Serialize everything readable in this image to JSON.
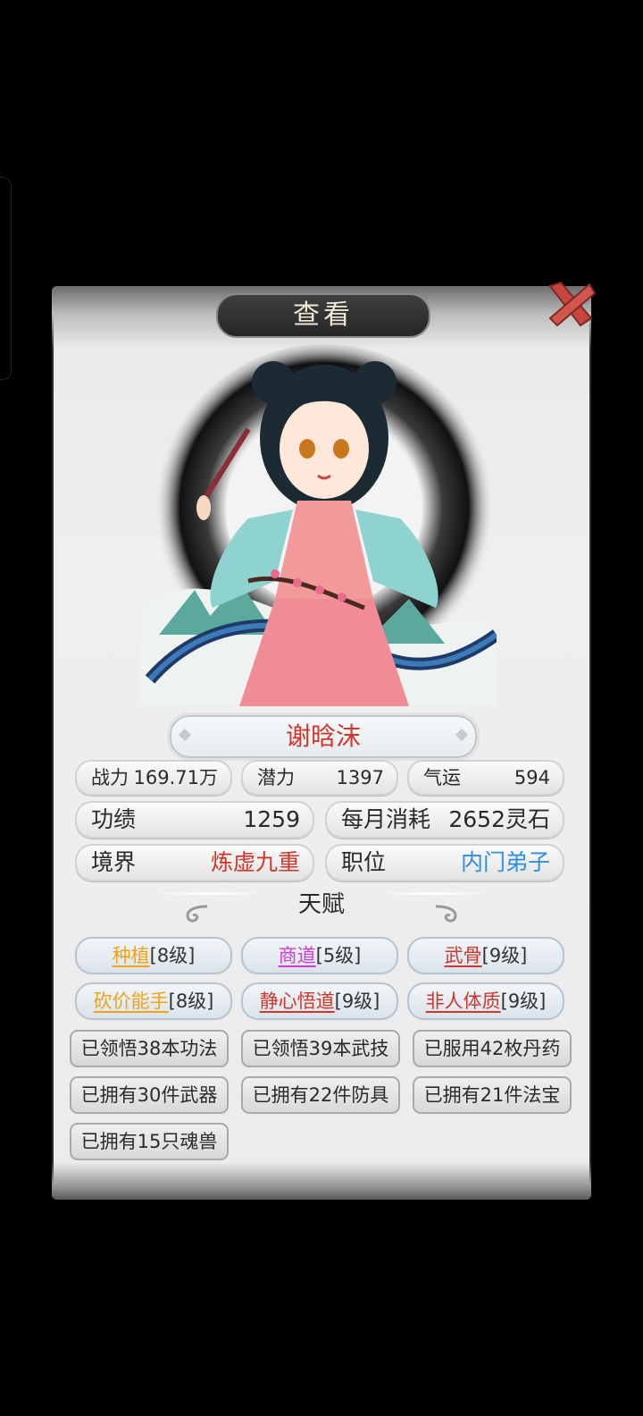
{
  "dialog": {
    "title": "查看"
  },
  "character": {
    "name": "谢晗沫"
  },
  "stats": {
    "combat_label": "战力",
    "combat_value": "169.71万",
    "potential_label": "潜力",
    "potential_value": "1397",
    "luck_label": "气运",
    "luck_value": "594",
    "merit_label": "功绩",
    "merit_value": "1259",
    "cost_label": "每月消耗",
    "cost_value": "2652灵石",
    "realm_label": "境界",
    "realm_value": "炼虚九重",
    "position_label": "职位",
    "position_value": "内门弟子"
  },
  "talents": {
    "title": "天赋",
    "items": [
      {
        "name": "种植",
        "level": "[8级]",
        "color": "#f0a21a"
      },
      {
        "name": "商道",
        "level": "[5级]",
        "color": "#d03ad8"
      },
      {
        "name": "武骨",
        "level": "[9级]",
        "color": "#d0362b"
      },
      {
        "name": "砍价能手",
        "level": "[8级]",
        "color": "#f0a21a"
      },
      {
        "name": "静心悟道",
        "level": "[9级]",
        "color": "#d0362b"
      },
      {
        "name": "非人体质",
        "level": "[9级]",
        "color": "#d0362b"
      }
    ]
  },
  "achievements": [
    "已领悟38本功法",
    "已领悟39本武技",
    "已服用42枚丹药",
    "已拥有30件武器",
    "已拥有22件防具",
    "已拥有21件法宝",
    "已拥有15只魂兽"
  ],
  "colors": {
    "accent_red": "#d0362b",
    "accent_blue": "#2f8fe0"
  },
  "icons": {
    "close": "close-x-icon"
  }
}
